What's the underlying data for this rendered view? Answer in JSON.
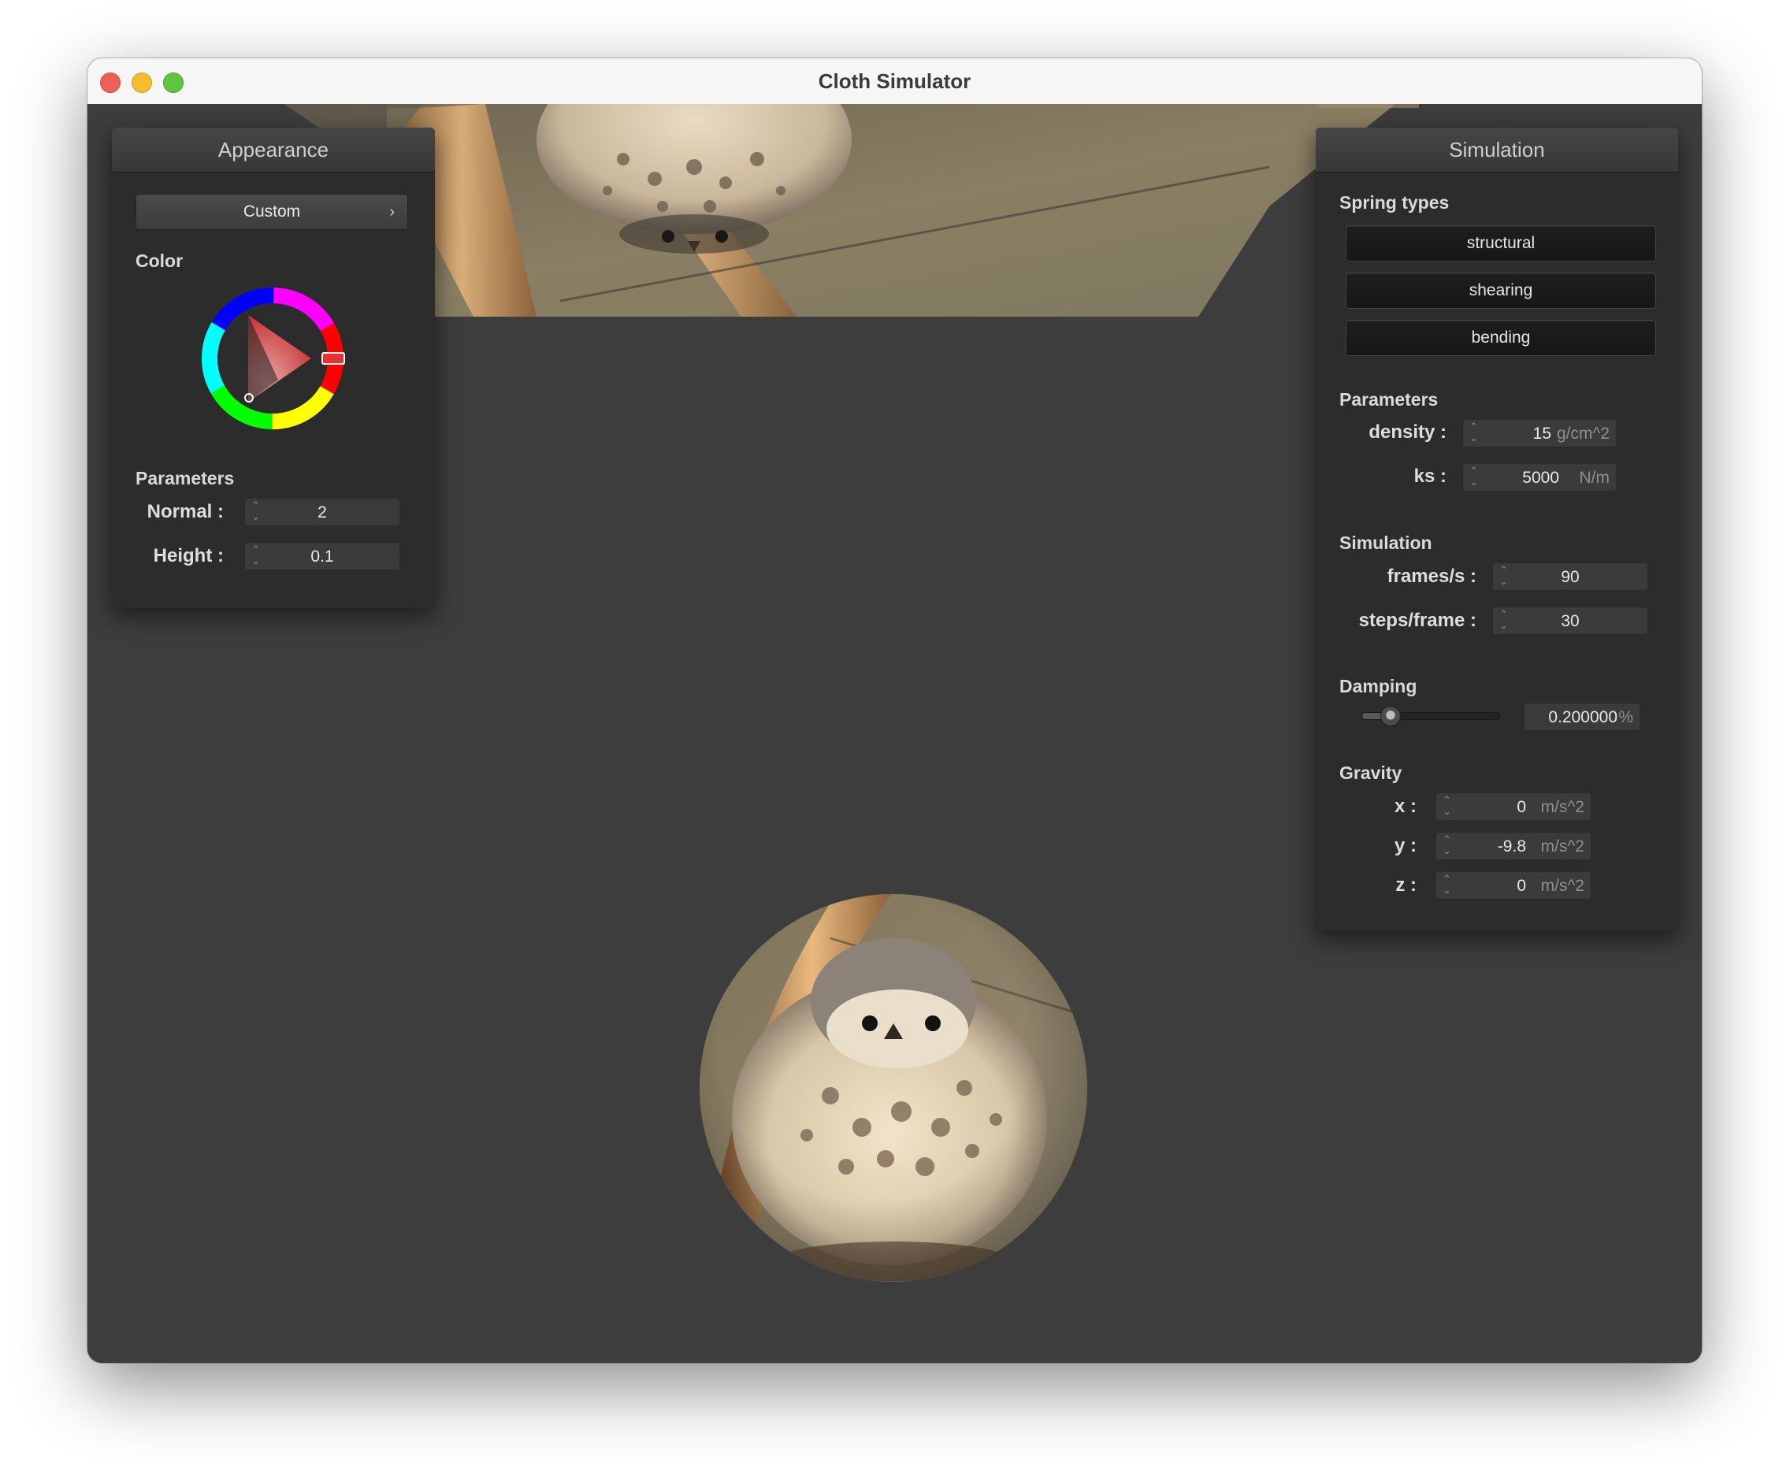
{
  "window": {
    "title": "Cloth Simulator"
  },
  "appearance": {
    "header": "Appearance",
    "preset": "Custom",
    "color_label": "Color",
    "selected_color": "#e63232",
    "params_label": "Parameters",
    "normal": {
      "label": "Normal :",
      "value": "2"
    },
    "height": {
      "label": "Height :",
      "value": "0.1"
    }
  },
  "simulation_panel": {
    "header": "Simulation",
    "spring_types_label": "Spring types",
    "spring_types": [
      "structural",
      "shearing",
      "bending"
    ],
    "params_label": "Parameters",
    "density": {
      "label": "density :",
      "value": "15",
      "unit": "g/cm^2"
    },
    "ks": {
      "label": "ks :",
      "value": "5000",
      "unit": "N/m"
    },
    "simulation_label": "Simulation",
    "fps": {
      "label": "frames/s :",
      "value": "90"
    },
    "steps": {
      "label": "steps/frame :",
      "value": "30"
    },
    "damping_label": "Damping",
    "damping": {
      "value": "0.200000",
      "unit": "%",
      "level": 0.2
    },
    "gravity_label": "Gravity",
    "gravity": [
      {
        "label": "x :",
        "value": "0",
        "unit": "m/s^2"
      },
      {
        "label": "y :",
        "value": "-9.8",
        "unit": "m/s^2"
      },
      {
        "label": "z :",
        "value": "0",
        "unit": "m/s^2"
      }
    ]
  }
}
